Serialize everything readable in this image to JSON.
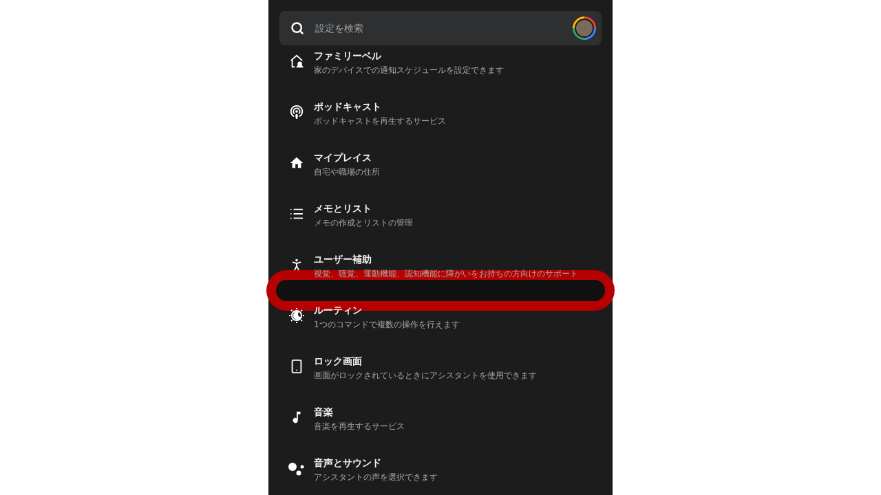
{
  "search": {
    "placeholder": "設定を検索"
  },
  "items": [
    {
      "kind": "family-bell",
      "title": "ファミリーベル",
      "subtitle": "家のデバイスでの通知スケジュールを設定できます"
    },
    {
      "kind": "podcast",
      "title": "ポッドキャスト",
      "subtitle": "ポッドキャストを再生するサービス"
    },
    {
      "kind": "home",
      "title": "マイプレイス",
      "subtitle": "自宅や職場の住所"
    },
    {
      "kind": "list",
      "title": "メモとリスト",
      "subtitle": "メモの作成とリストの管理"
    },
    {
      "kind": "accessibility",
      "title": "ユーザー補助",
      "subtitle": "視覚、聴覚、運動機能、認知機能に障がいをお持ちの方向けのサポート"
    },
    {
      "kind": "routine",
      "title": "ルーティン",
      "subtitle": "1つのコマンドで複数の操作を行えます"
    },
    {
      "kind": "lock-screen",
      "title": "ロック画面",
      "subtitle": "画面がロックされているときにアシスタントを使用できます"
    },
    {
      "kind": "music",
      "title": "音楽",
      "subtitle": "音楽を再生するサービス"
    },
    {
      "kind": "voice",
      "title": "音声とサウンド",
      "subtitle": "アシスタントの声を選択できます"
    }
  ]
}
